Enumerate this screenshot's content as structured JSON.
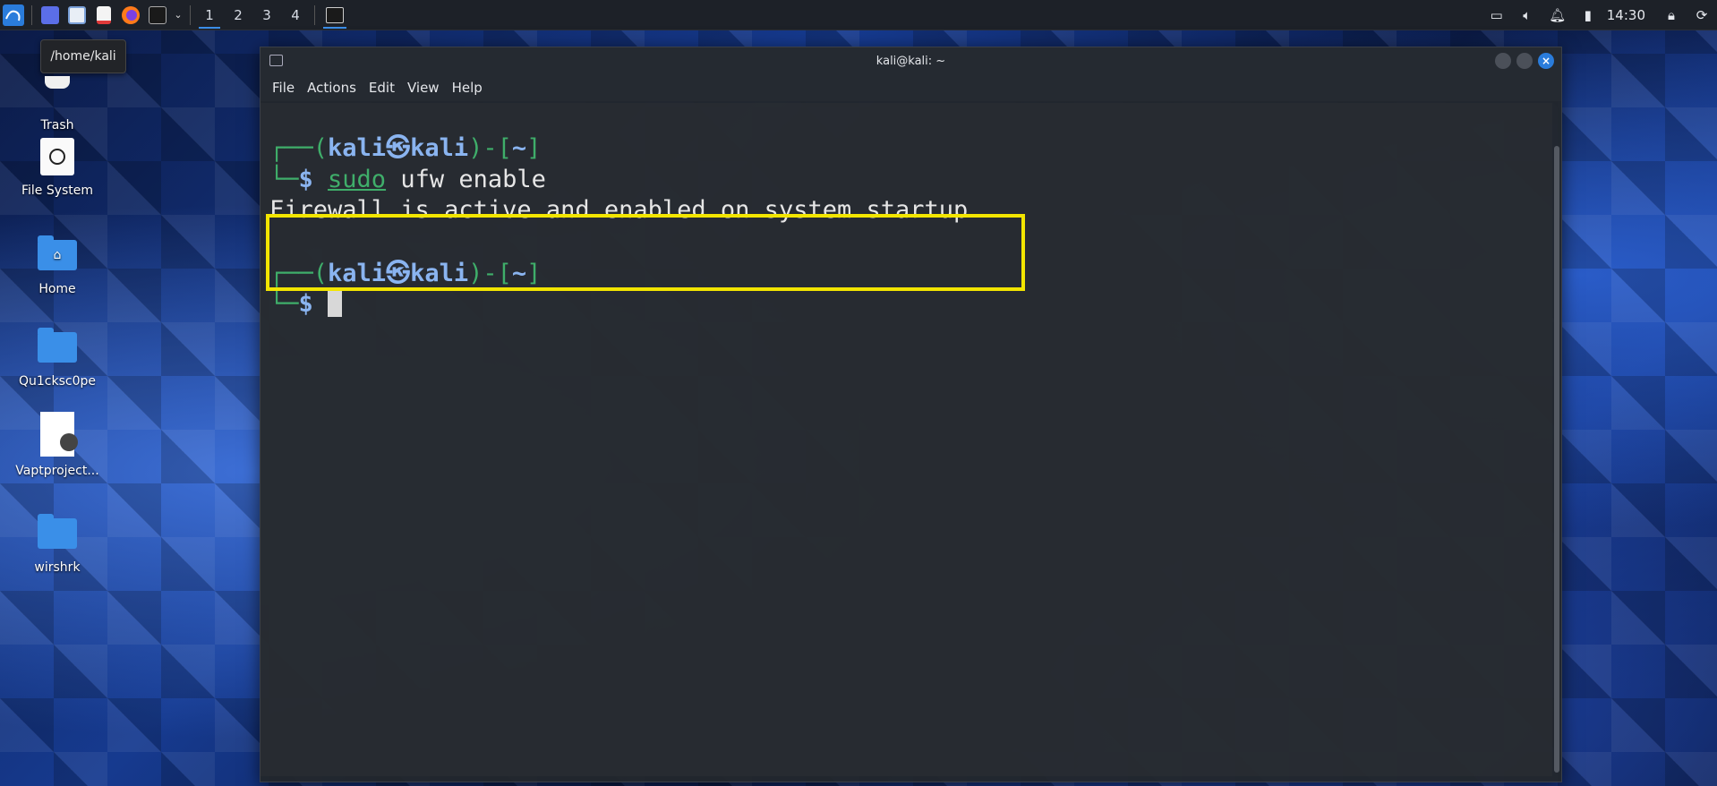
{
  "taskbar": {
    "workspaces": [
      "1",
      "2",
      "3",
      "4"
    ],
    "clock": "14:30"
  },
  "tooltip": "/home/kali",
  "desktop": {
    "icons": [
      {
        "label": "Trash"
      },
      {
        "label": "File System"
      },
      {
        "label": "Home"
      },
      {
        "label": "Qu1cksc0pe"
      },
      {
        "label": "Vaptproject..."
      },
      {
        "label": "wirshrk"
      }
    ]
  },
  "terminal": {
    "title": "kali@kali: ~",
    "menu": [
      "File",
      "Actions",
      "Edit",
      "View",
      "Help"
    ],
    "prompt_user": "kali",
    "prompt_host": "kali",
    "prompt_dir": "~",
    "command_sudo": "sudo",
    "command_rest": " ufw enable",
    "output": "Firewall is active and enabled on system startup"
  },
  "colors": {
    "highlight": "#f2e500",
    "prompt_green": "#3fae6a",
    "prompt_blue": "#8ab4f0"
  }
}
